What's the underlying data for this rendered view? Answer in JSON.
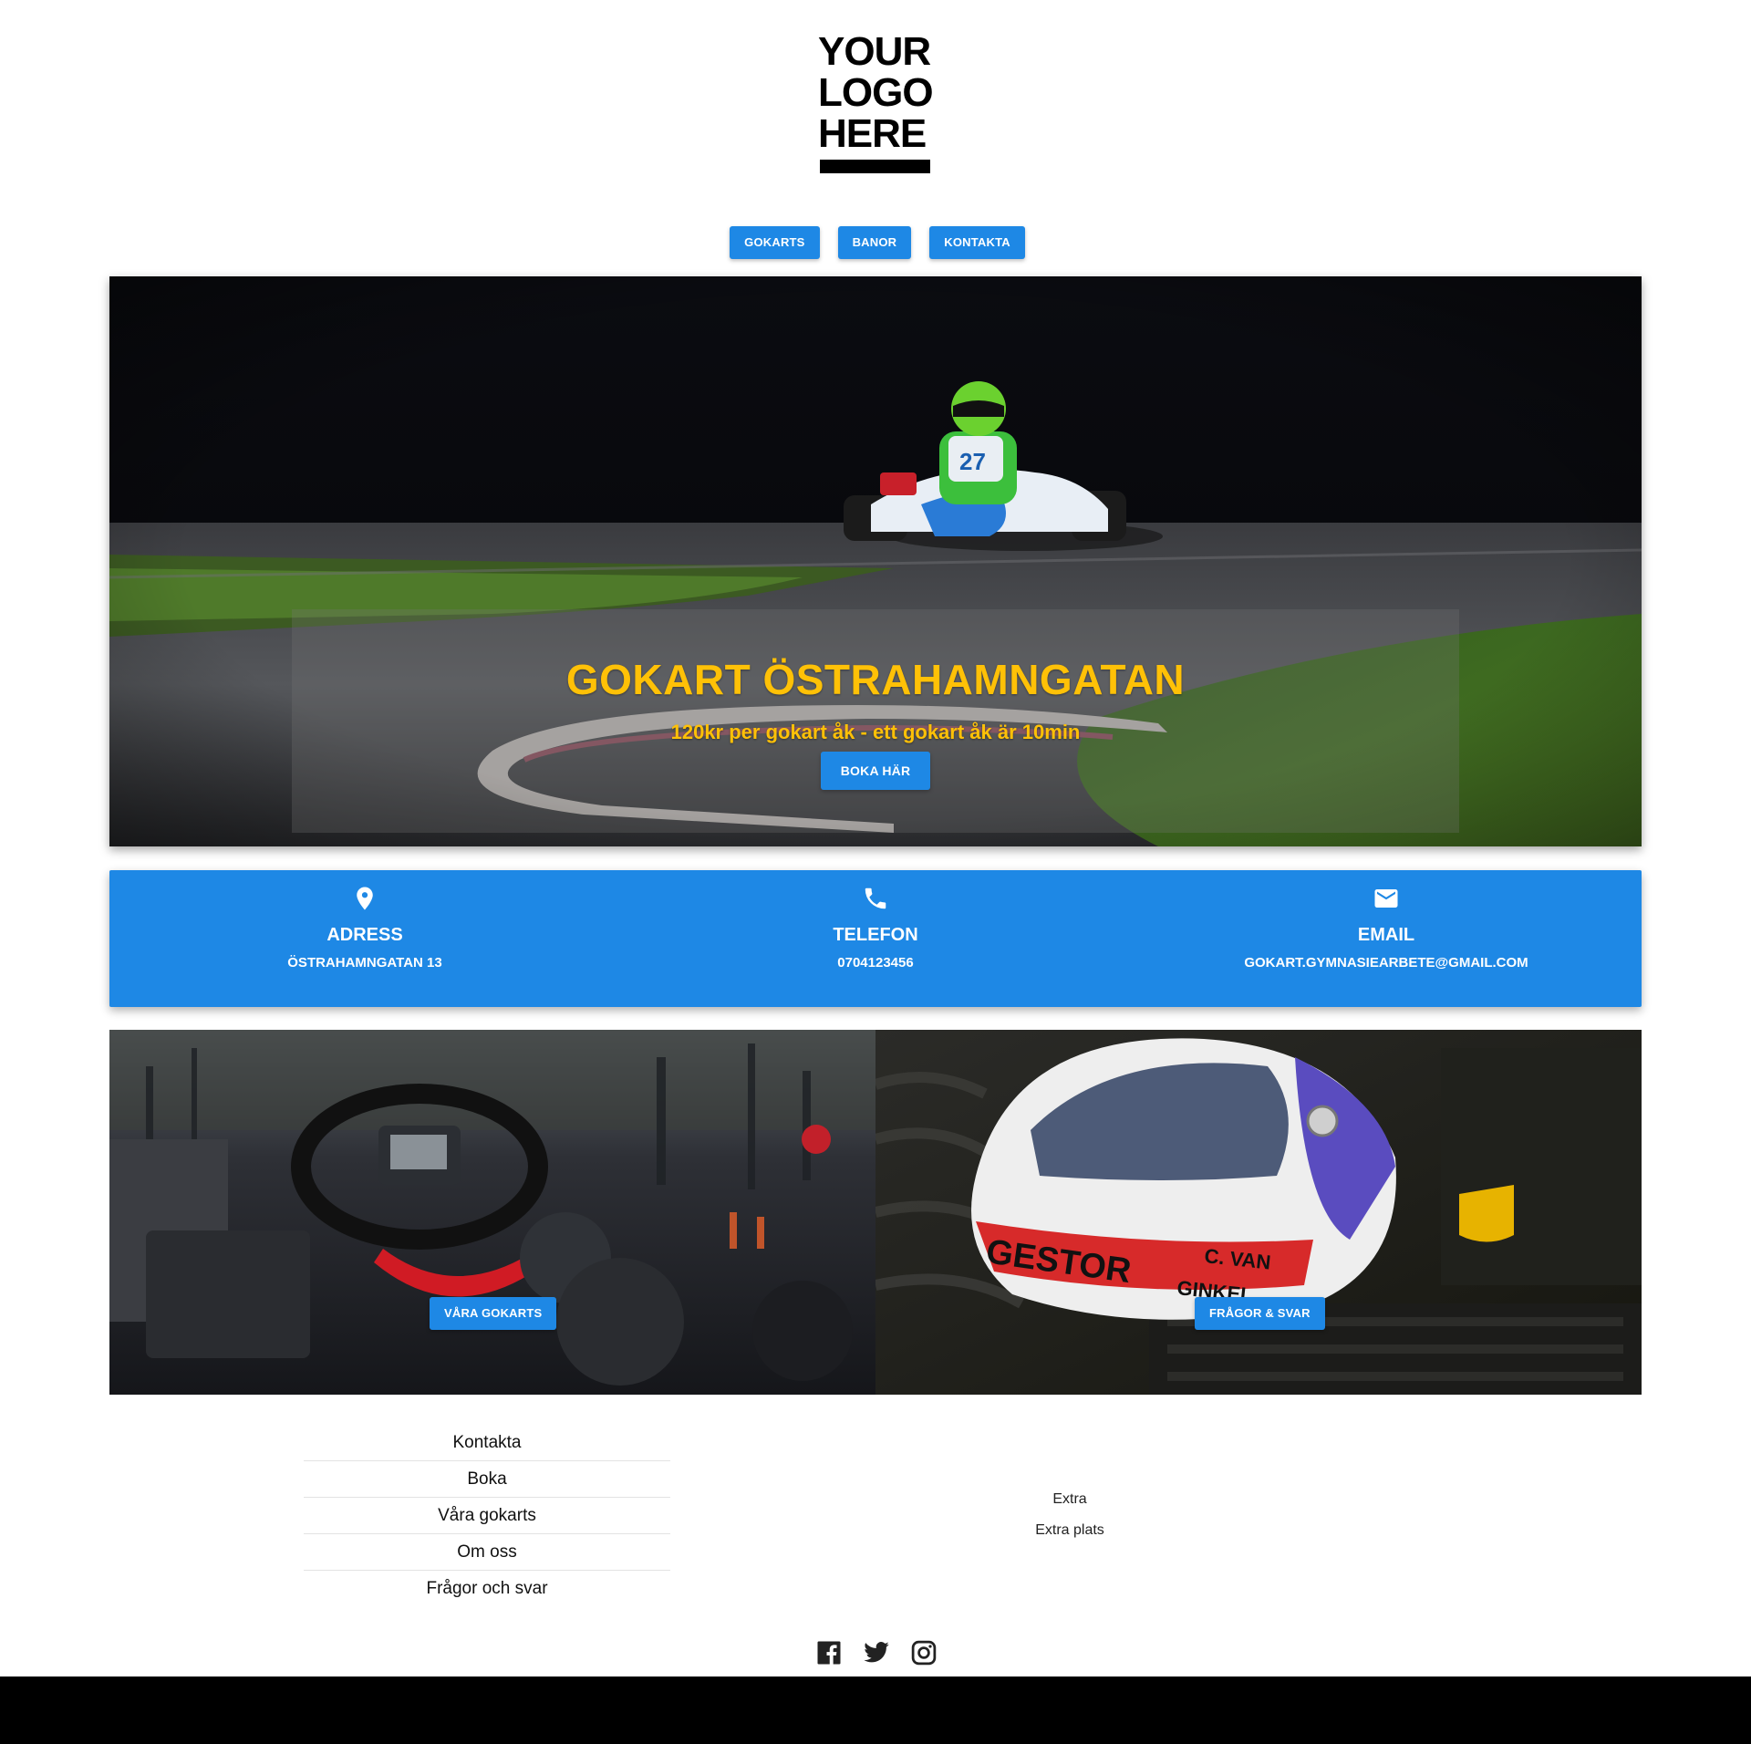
{
  "logo": {
    "line1": "YOUR",
    "line2": "LOGO",
    "line3": "HERE"
  },
  "nav": {
    "items": [
      {
        "label": "GOKARTS"
      },
      {
        "label": "BANOR"
      },
      {
        "label": "KONTAKTA"
      }
    ]
  },
  "hero": {
    "title": "GOKART ÖSTRAHAMNGATAN",
    "subtitle": "120kr per gokart åk - ett gokart åk är 10min",
    "cta_label": "BOKA HÄR"
  },
  "info": {
    "columns": [
      {
        "icon": "location-pin-icon",
        "title": "ADRESS",
        "value": "ÖSTRAHAMNGATAN 13"
      },
      {
        "icon": "phone-icon",
        "title": "TELEFON",
        "value": "0704123456"
      },
      {
        "icon": "email-icon",
        "title": "EMAIL",
        "value": "GOKART.GYMNASIEARBETE@GMAIL.COM"
      }
    ]
  },
  "tiles": [
    {
      "button_label": "VÅRA GOKARTS"
    },
    {
      "button_label": "FRÅGOR & SVAR"
    }
  ],
  "footer": {
    "links": [
      "Kontakta",
      "Boka",
      "Våra gokarts",
      "Om oss",
      "Frågor och svar"
    ],
    "extra": [
      "Extra",
      "Extra plats"
    ],
    "social": [
      "facebook-icon",
      "twitter-icon",
      "instagram-icon"
    ]
  },
  "colors": {
    "primary": "#1e88e5",
    "hero_text": "#ffc107",
    "footer_bar": "#000000"
  }
}
